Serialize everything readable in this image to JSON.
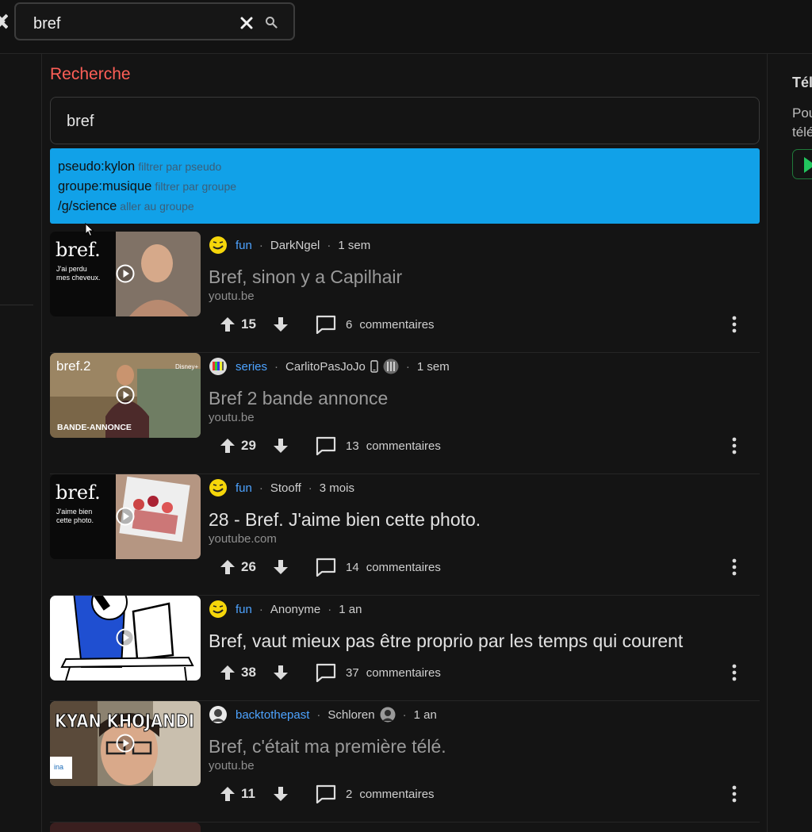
{
  "topbar": {
    "search_value": "bref"
  },
  "sidebar_right": {
    "title": "Tél",
    "text_line1": "Pou",
    "text_line2": "télé"
  },
  "main": {
    "title": "Recherche",
    "search_value": "bref",
    "suggestions": [
      {
        "label": "pseudo:kylon",
        "hint": "filtrer par pseudo"
      },
      {
        "label": "groupe:musique",
        "hint": "filtrer par groupe"
      },
      {
        "label": "/g/science",
        "hint": "aller au groupe"
      }
    ]
  },
  "posts": [
    {
      "group": "fun",
      "author": "DarkNgel",
      "time": "1 sem",
      "title": "Bref, sinon y a Capilhair",
      "domain": "youtu.be",
      "votes": "15",
      "comments": "6",
      "comments_label": "commentaires",
      "thumb_text1": "bref.",
      "thumb_text2": "J'ai perdu",
      "thumb_text3": "mes cheveux."
    },
    {
      "group": "series",
      "author": "CarlitoPasJoJo",
      "time": "1 sem",
      "title": "Bref 2 bande annonce",
      "domain": "youtu.be",
      "votes": "29",
      "comments": "13",
      "comments_label": "commentaires",
      "thumb_text1": "bref.2",
      "thumb_text2": "BANDE-ANNONCE",
      "thumb_text3": "Disney+"
    },
    {
      "group": "fun",
      "author": "Stooff",
      "time": "3 mois",
      "title": "28 - Bref. J'aime bien cette photo.",
      "domain": "youtube.com",
      "votes": "26",
      "comments": "14",
      "comments_label": "commentaires",
      "thumb_text1": "bref.",
      "thumb_text2": "J'aime bien",
      "thumb_text3": "cette photo."
    },
    {
      "group": "fun",
      "author": "Anonyme",
      "time": "1 an",
      "title": "Bref, vaut mieux pas être proprio par les temps qui courent",
      "domain": "",
      "votes": "38",
      "comments": "37",
      "comments_label": "commentaires"
    },
    {
      "group": "backtothepast",
      "author": "Schloren",
      "time": "1 an",
      "title": "Bref, c'était ma première télé.",
      "domain": "youtu.be",
      "votes": "11",
      "comments": "2",
      "comments_label": "commentaires",
      "thumb_text1": "KYAN KHOJANDI",
      "thumb_text2": "ina"
    }
  ],
  "colors": {
    "accent": "#ff5f57",
    "suggest_bg": "#11a1e8",
    "link": "#4da3ff",
    "bg": "#141414"
  }
}
